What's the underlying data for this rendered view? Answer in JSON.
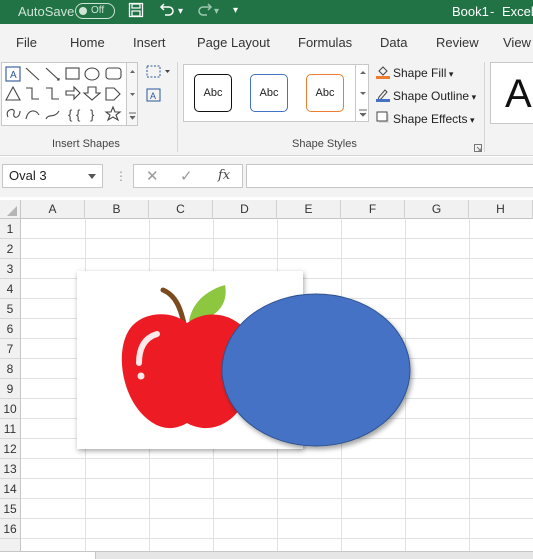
{
  "titlebar": {
    "autosave_label": "AutoSave",
    "autosave_state": "Off",
    "workbook": "Book1",
    "separator": "-",
    "app": "Excel"
  },
  "tabs": [
    "File",
    "Home",
    "Insert",
    "Page Layout",
    "Formulas",
    "Data",
    "Review",
    "View"
  ],
  "ribbon": {
    "insert_shapes_label": "Insert Shapes",
    "shape_styles_label": "Shape Styles",
    "style_swatches": [
      "Abc",
      "Abc",
      "Abc"
    ],
    "shape_fill": "Shape Fill",
    "shape_outline": "Shape Outline",
    "shape_effects": "Shape Effects",
    "wordart_letter": "A"
  },
  "formula_bar": {
    "name_box": "Oval 3",
    "fx": "fx",
    "value": ""
  },
  "grid": {
    "columns": [
      "A",
      "B",
      "C",
      "D",
      "E",
      "F",
      "G",
      "H"
    ],
    "rows": [
      "1",
      "2",
      "3",
      "4",
      "5",
      "6",
      "7",
      "8",
      "9",
      "10",
      "11",
      "12",
      "13",
      "14",
      "15",
      "16"
    ]
  },
  "colors": {
    "excel_green": "#217346",
    "oval_fill": "#4472c4",
    "oval_stroke": "#2f528f",
    "apple_red": "#ed1c24",
    "leaf_green": "#8dc63f"
  }
}
